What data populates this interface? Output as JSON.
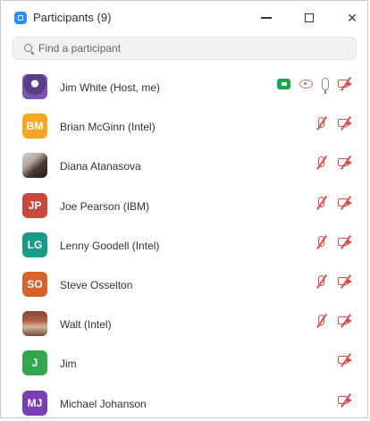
{
  "window": {
    "title": "Participants (9)",
    "minimize_label": "",
    "maximize_label": "",
    "close_label": "×"
  },
  "search": {
    "placeholder": "Find a participant"
  },
  "participants": [
    {
      "name": "Jim White (Host, me)",
      "avatar_type": "photo",
      "avatar_initials": "",
      "avatar_color": "#6b3fa0",
      "icons": [
        "host-video-icon",
        "view-icon",
        "microphone-icon",
        "video-off-icon"
      ]
    },
    {
      "name": "Brian McGinn (Intel)",
      "avatar_type": "initials",
      "avatar_initials": "BM",
      "avatar_color": "#f5a623",
      "icons": [
        "mute-icon",
        "video-off-icon"
      ]
    },
    {
      "name": "Diana Atanasova",
      "avatar_type": "photo",
      "avatar_initials": "",
      "avatar_color": "#6f5b5a",
      "icons": [
        "mute-icon",
        "video-off-icon"
      ]
    },
    {
      "name": "Joe Pearson (IBM)",
      "avatar_type": "initials",
      "avatar_initials": "JP",
      "avatar_color": "#c94a3c",
      "icons": [
        "mute-icon",
        "video-off-icon"
      ]
    },
    {
      "name": "Lenny Goodell (Intel)",
      "avatar_type": "initials",
      "avatar_initials": "LG",
      "avatar_color": "#179c87",
      "icons": [
        "mute-icon",
        "video-off-icon"
      ]
    },
    {
      "name": "Steve Osselton",
      "avatar_type": "initials",
      "avatar_initials": "SO",
      "avatar_color": "#d9622b",
      "icons": [
        "mute-icon",
        "video-off-icon"
      ]
    },
    {
      "name": "Walt (Intel)",
      "avatar_type": "photo",
      "avatar_initials": "",
      "avatar_color": "#9c5f45",
      "icons": [
        "mute-icon",
        "video-off-icon"
      ]
    },
    {
      "name": "Jim",
      "avatar_type": "initials",
      "avatar_initials": "J",
      "avatar_color": "#31a84f",
      "icons": [
        "video-off-icon"
      ]
    },
    {
      "name": "Michael Johanson",
      "avatar_type": "initials",
      "avatar_initials": "MJ",
      "avatar_color": "#7b3fb5",
      "icons": [
        "video-off-icon"
      ]
    }
  ]
}
